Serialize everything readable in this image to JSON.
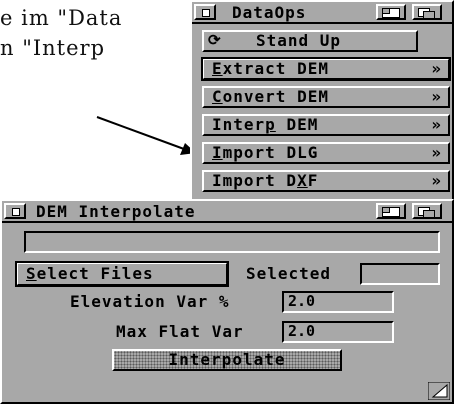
{
  "background_text": {
    "line1": "e im \"Data",
    "line2": "n \"Interp"
  },
  "dataops": {
    "title": "DataOps",
    "stand_up": "Stand Up",
    "items": [
      {
        "label": "Extract DEM",
        "underline": "E",
        "arrow": "»"
      },
      {
        "label": "Convert DEM",
        "underline": "C",
        "arrow": "»"
      },
      {
        "label": "Interp DEM",
        "underline": "p",
        "arrow": "»"
      },
      {
        "label": "Import DLG",
        "underline": "I",
        "arrow": "»"
      },
      {
        "label": "Import DXF",
        "underline": "X",
        "arrow": "»"
      }
    ]
  },
  "interp": {
    "title": "DEM Interpolate",
    "select_files": "Select Files",
    "selected_label": "Selected",
    "selected_value": "",
    "status_value": "",
    "elev_label": "Elevation Var %",
    "elev_value": "2.0",
    "flat_label": "Max Flat Var",
    "flat_value": "2.0",
    "interpolate": "Interpolate"
  },
  "colors": {
    "window": "#a8a8a8",
    "highlight": "#ffffff",
    "shadow": "#000000"
  }
}
